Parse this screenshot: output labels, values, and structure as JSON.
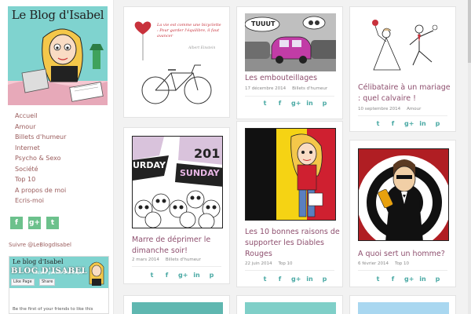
{
  "blog": {
    "title": "Le Blog d'Isabel"
  },
  "nav": [
    "Accueil",
    "Amour",
    "Billets d'humeur",
    "Internet",
    "Psycho & Sexo",
    "Société",
    "Top 10",
    "A propos de moi",
    "Ecris-moi"
  ],
  "sidebar_social": [
    {
      "name": "facebook",
      "glyph": "f"
    },
    {
      "name": "googleplus",
      "glyph": "g+"
    },
    {
      "name": "twitter",
      "glyph": "t"
    }
  ],
  "follow_link": "Suivre @LeBlogdIsabel",
  "fb_widget": {
    "page_name": "Le blog d'Isabel",
    "big_title": "BLOG D'ISABEL",
    "description": "société passée à la loupe",
    "like_label": "Like Page",
    "share_label": "Share",
    "friends_text": "Be the first of your friends to like this"
  },
  "cards": [
    {
      "id": "velo",
      "title": "",
      "date": "",
      "category": "",
      "quote": "La vie est comme une bicyclette : Pour garder l'équilibre, il faut avancer",
      "signature": "Albert Einstein"
    },
    {
      "id": "embouteillages",
      "title": "Les embouteillages",
      "date": "17 décembre 2014",
      "category": "Billets d'humeur",
      "balloon": "TUUUT"
    },
    {
      "id": "mariage",
      "title": "Célibataire à un mariage : quel calvaire !",
      "date": "10 septembre 2014",
      "category": "Amour"
    },
    {
      "id": "dimanche",
      "title": "Marre de déprimer le dimanche soir!",
      "date": "2 mars 2014",
      "category": "Billets d'humeur",
      "strip_top": "201",
      "strip_left": "URDAY",
      "strip_right": "SUNDAY"
    },
    {
      "id": "diables",
      "title": "Les 10 bonnes raisons de supporter les Diables Rouges",
      "date": "22 juin 2014",
      "category": "Top 10"
    },
    {
      "id": "homme",
      "title": "A quoi sert un homme?",
      "date": "6 février 2014",
      "category": "Top 10"
    }
  ],
  "share_icons": [
    {
      "name": "twitter",
      "glyph": "t"
    },
    {
      "name": "facebook",
      "glyph": "f"
    },
    {
      "name": "googleplus",
      "glyph": "g+"
    },
    {
      "name": "linkedin",
      "glyph": "in"
    },
    {
      "name": "pinterest",
      "glyph": "p"
    }
  ],
  "colors": {
    "accent_teal": "#7fd3cf",
    "title_color": "#8e4f6e",
    "nav_color": "#9a5c5c",
    "social_green": "#6cc18c",
    "share_teal": "#4aa9a4"
  }
}
